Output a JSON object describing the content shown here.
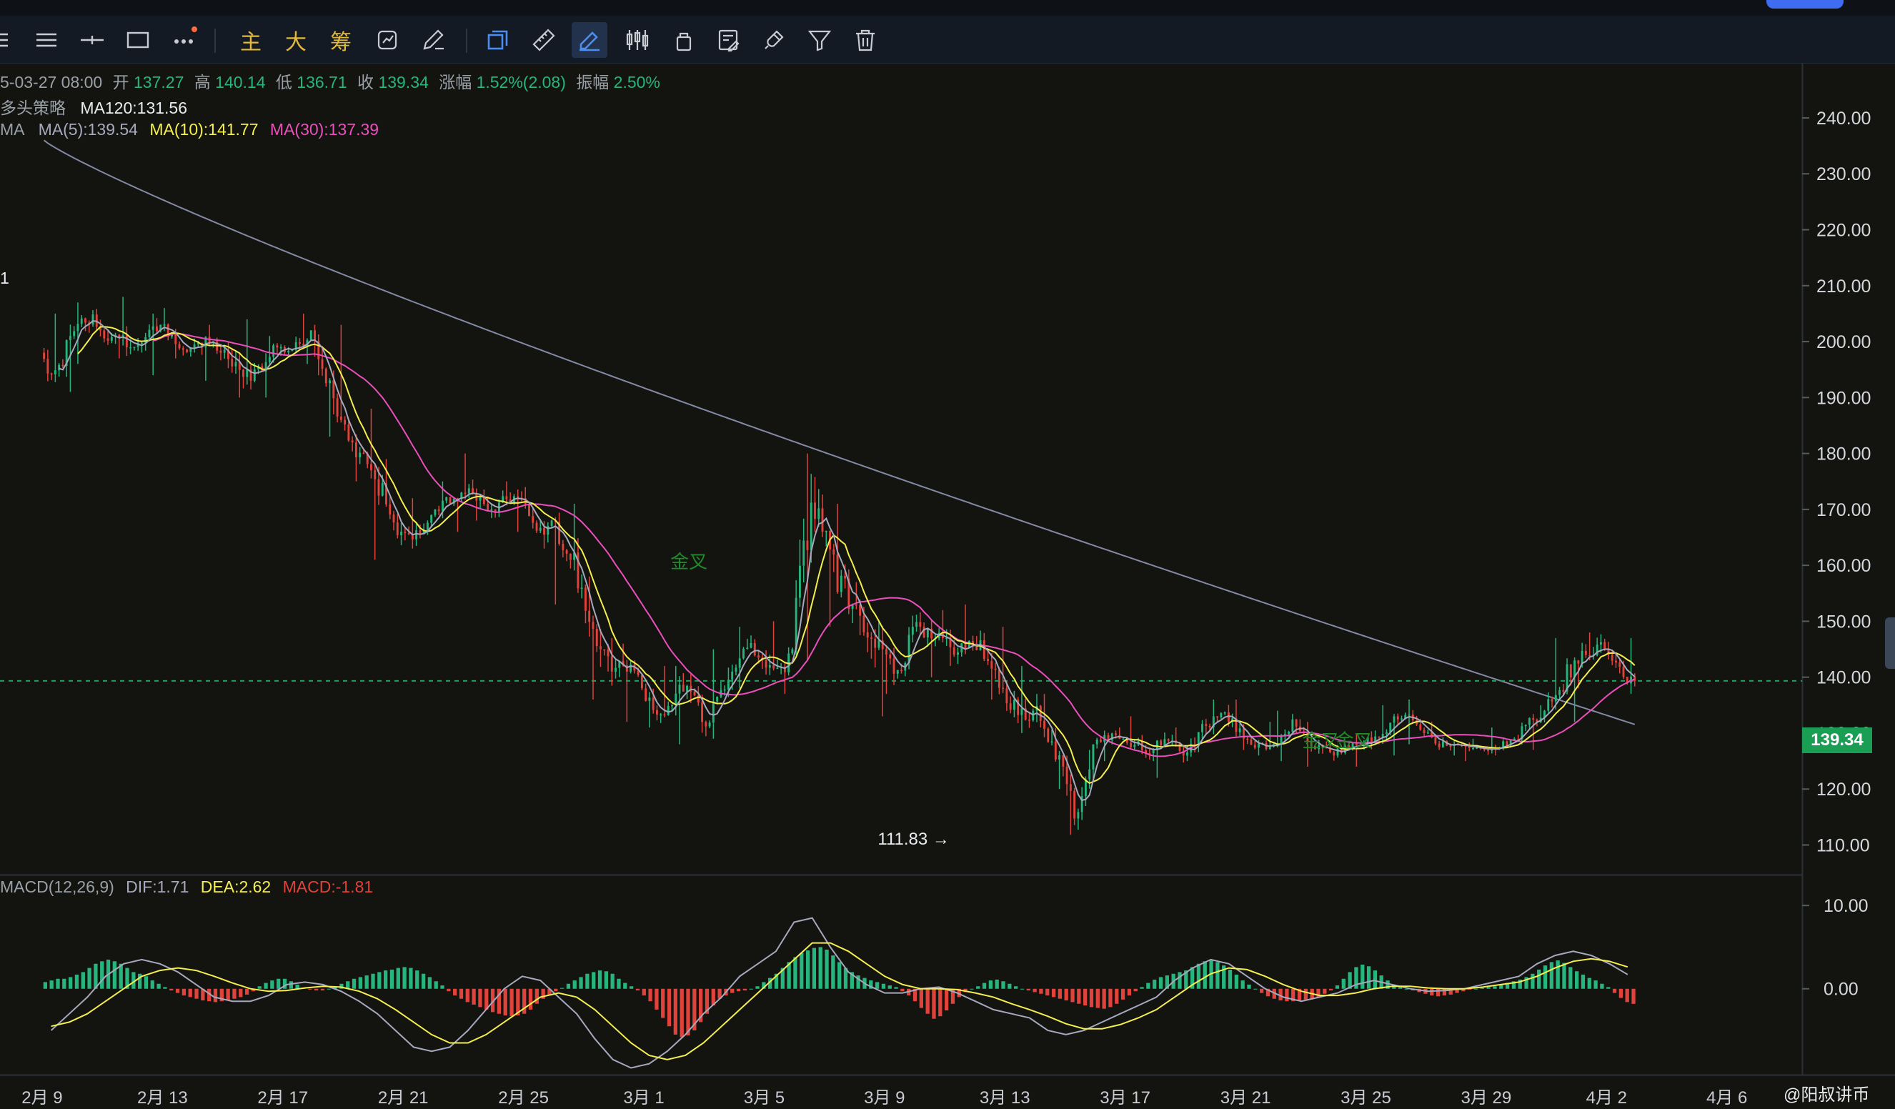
{
  "toolbar": {
    "text_buttons": [
      "主",
      "大",
      "筹"
    ]
  },
  "info_bar": {
    "date": "5-03-27 08:00",
    "open_label": "开",
    "open": "137.27",
    "high_label": "高",
    "high": "140.14",
    "low_label": "低",
    "low": "136.71",
    "close_label": "收",
    "close": "139.34",
    "change_label": "涨幅",
    "change": "1.52%(2.08)",
    "amplitude_label": "振幅",
    "amplitude": "2.50%"
  },
  "strategy_bar": {
    "name": "多头策略",
    "ma120": "MA120:131.56"
  },
  "ma_bar": {
    "prefix": "MA",
    "ma5": "MA(5):139.54",
    "ma10": "MA(10):141.77",
    "ma30": "MA(30):137.39"
  },
  "left_mark": "1",
  "macd_bar": {
    "name": "MACD(12,26,9)",
    "dif": "DIF:1.71",
    "dea": "DEA:2.62",
    "macd": "MACD:-1.81"
  },
  "watermark": "@阳叔讲币",
  "colors": {
    "background": "#131410",
    "up": "#26b57c",
    "down": "#e0423c",
    "ma5": "#a6a9bd",
    "ma10": "#f4ee4f",
    "ma30": "#ea4fbb",
    "ma120": "#8489a6",
    "last_price_tag": "#1a9e53",
    "cross_marker": "#1f8a2a"
  },
  "chart_data": [
    {
      "type": "candlestick",
      "title": "",
      "y_ticks": [
        "240.00",
        "230.00",
        "220.00",
        "210.00",
        "200.00",
        "190.00",
        "180.00",
        "170.00",
        "160.00",
        "150.00",
        "140.00",
        "130.00",
        "120.00",
        "110.00"
      ],
      "ylim": [
        107,
        246
      ],
      "x_ticks": [
        "2月 9",
        "2月 13",
        "2月 17",
        "2月 21",
        "2月 25",
        "3月 1",
        "3月 5",
        "3月 9",
        "3月 13",
        "3月 17",
        "3月 21",
        "3月 25",
        "3月 29",
        "4月 2",
        "4月 6"
      ],
      "x_tick_days": [
        0,
        4,
        8,
        12,
        16,
        20,
        24,
        28,
        32,
        36,
        40,
        44,
        48,
        52,
        56
      ],
      "x_range_days": [
        -1.4,
        58.5
      ],
      "last_price": "139.34",
      "low_marker": {
        "day": 30.4,
        "value": 111.83,
        "label": "111.83 →"
      },
      "cross_markers": [
        {
          "day": 21.5,
          "value": 159.5,
          "label": "金叉"
        },
        {
          "day": 42.5,
          "value": 127.5,
          "label": "金叉"
        },
        {
          "day": 43.6,
          "value": 127.5,
          "label": "金叉"
        }
      ],
      "daily_ohlc": [
        [
          198,
          205,
          191,
          201
        ],
        [
          201,
          207,
          196,
          202
        ],
        [
          202,
          208,
          197,
          199
        ],
        [
          199,
          205,
          194,
          203
        ],
        [
          203,
          206,
          197,
          199
        ],
        [
          199,
          203,
          193,
          198
        ],
        [
          198,
          204,
          190,
          193
        ],
        [
          193,
          201,
          190,
          199
        ],
        [
          199,
          205,
          196,
          202
        ],
        [
          202,
          203,
          183,
          186
        ],
        [
          186,
          188,
          175,
          177
        ],
        [
          177,
          179,
          161,
          166
        ],
        [
          166,
          172,
          163,
          169
        ],
        [
          169,
          175,
          166,
          173
        ],
        [
          173,
          180,
          168,
          170
        ],
        [
          170,
          175,
          166,
          172
        ],
        [
          172,
          174,
          163,
          168
        ],
        [
          168,
          171,
          153,
          156
        ],
        [
          156,
          158,
          136,
          141
        ],
        [
          141,
          146,
          132,
          138
        ],
        [
          138,
          142,
          131,
          135
        ],
        [
          135,
          142,
          128,
          132
        ],
        [
          132,
          145,
          129,
          141
        ],
        [
          141,
          149,
          138,
          143
        ],
        [
          143,
          150,
          137,
          145
        ],
        [
          145,
          180,
          143,
          166
        ],
        [
          166,
          171,
          149,
          153
        ],
        [
          153,
          157,
          133,
          145
        ],
        [
          145,
          151,
          137,
          149
        ],
        [
          149,
          152,
          140,
          147
        ],
        [
          147,
          153,
          142,
          146
        ],
        [
          146,
          149,
          136,
          138
        ],
        [
          138,
          142,
          130,
          134
        ],
        [
          134,
          137,
          120,
          124
        ],
        [
          124,
          127,
          111.83,
          128
        ],
        [
          128,
          131,
          125,
          129
        ],
        [
          129,
          133,
          125,
          127
        ],
        [
          127,
          131,
          122,
          126
        ],
        [
          126,
          136,
          125,
          133
        ],
        [
          133,
          136,
          127,
          129
        ],
        [
          129,
          132,
          126,
          128
        ],
        [
          128,
          134,
          125,
          130
        ],
        [
          130,
          132,
          124,
          126
        ],
        [
          126,
          130,
          124,
          128
        ],
        [
          128,
          135,
          126,
          133
        ],
        [
          133,
          136,
          128,
          130
        ],
        [
          130,
          132,
          126,
          128
        ],
        [
          128,
          129,
          125,
          127
        ],
        [
          127,
          131,
          126,
          129
        ],
        [
          129,
          135,
          127,
          134
        ],
        [
          134,
          147,
          132,
          143
        ],
        [
          143,
          148,
          138,
          145
        ],
        [
          145,
          147,
          137,
          139.34
        ]
      ]
    },
    {
      "type": "macd",
      "title": "",
      "y_ticks": [
        "10.00",
        "0.00"
      ],
      "ylim": [
        -9.8,
        12.5
      ],
      "series": [
        {
          "name": "DIF",
          "values": [
            -5,
            -3,
            -1,
            1.5,
            3,
            3.5,
            3,
            2,
            0.5,
            -1,
            -1.5,
            -1.5,
            -0.8,
            0.5,
            0.8,
            0.5,
            -0.3,
            -1.5,
            -3,
            -5,
            -7,
            -7.5,
            -7,
            -5,
            -2.5,
            0,
            1.5,
            1,
            -1,
            -3,
            -6,
            -8.5,
            -9.5,
            -9,
            -7.5,
            -5.5,
            -3,
            -1,
            1.5,
            3,
            4.5,
            8,
            8.5,
            5,
            2,
            0.5,
            -0.5,
            -0.5,
            0,
            0.2,
            -0.5,
            -1.5,
            -2.5,
            -3,
            -3.5,
            -5,
            -5.5,
            -5,
            -4,
            -3,
            -2,
            -1,
            1,
            2.5,
            3.5,
            3,
            1.5,
            0,
            -1,
            -1.5,
            -1,
            -0.5,
            0.5,
            1,
            0.5,
            0,
            -0.3,
            -0.2,
            0,
            0.5,
            1,
            1.5,
            3,
            4,
            4.5,
            4,
            3,
            1.71
          ]
        },
        {
          "name": "DEA",
          "values": [
            -4.5,
            -4,
            -3,
            -1.5,
            0,
            1.5,
            2.2,
            2.5,
            2.2,
            1.5,
            0.7,
            0,
            -0.3,
            -0.2,
            0.1,
            0.3,
            0.2,
            -0.3,
            -1.2,
            -2.5,
            -4,
            -5.5,
            -6.5,
            -6.5,
            -5.5,
            -4,
            -2.5,
            -1,
            -0.5,
            -1,
            -2.5,
            -4.5,
            -6.5,
            -8,
            -8.5,
            -8,
            -6.5,
            -4.5,
            -2.5,
            -0.5,
            1.5,
            3.5,
            5.5,
            5.5,
            4.5,
            3,
            1.5,
            0.5,
            0,
            0,
            -0.1,
            -0.5,
            -1,
            -1.8,
            -2.5,
            -3.3,
            -4.2,
            -4.8,
            -4.8,
            -4.3,
            -3.5,
            -2.5,
            -1,
            0.5,
            1.8,
            2.5,
            2.3,
            1.5,
            0.5,
            -0.3,
            -0.8,
            -0.8,
            -0.5,
            0,
            0.3,
            0.3,
            0.1,
            0,
            0,
            0.2,
            0.5,
            0.8,
            1.5,
            2.5,
            3.3,
            3.6,
            3.3,
            2.62
          ]
        }
      ],
      "histogram": [
        0.8,
        1,
        1.2,
        1.2,
        1.4,
        1.7,
        2,
        2.5,
        3,
        3.3,
        3.5,
        3.3,
        3,
        2.5,
        2,
        1.8,
        1.5,
        1,
        0.6,
        0.2,
        -0.2,
        -0.5,
        -0.8,
        -1,
        -1.2,
        -1.4,
        -1.5,
        -1.6,
        -1.5,
        -1.4,
        -1.2,
        -1,
        -0.7,
        -0.3,
        0.3,
        0.7,
        1,
        1.2,
        1.2,
        0.9,
        0.5,
        0.1,
        -0.1,
        -0.2,
        -0.2,
        0,
        0.3,
        0.6,
        0.9,
        1.2,
        1.4,
        1.6,
        1.8,
        2,
        2.2,
        2.3,
        2.5,
        2.6,
        2.5,
        2.2,
        1.8,
        1.4,
        0.9,
        0.4,
        -0.3,
        -0.8,
        -1.2,
        -1.6,
        -1.9,
        -2.2,
        -2.5,
        -2.8,
        -3,
        -3.2,
        -3.3,
        -3.2,
        -3,
        -2.5,
        -1.8,
        -1.2,
        -0.8,
        -0.3,
        0.1,
        0.6,
        1,
        1.4,
        1.8,
        2,
        2.2,
        2.1,
        1.8,
        1.2,
        0.7,
        0.3,
        -0.2,
        -0.8,
        -1.5,
        -2.5,
        -3.5,
        -4.5,
        -5.5,
        -5.8,
        -5.6,
        -5,
        -4,
        -3,
        -2,
        -1.2,
        -0.8,
        -0.5,
        -0.3,
        -0.2,
        0,
        0.3,
        0.8,
        1.3,
        1.8,
        2.5,
        3.2,
        3.8,
        4.3,
        4.6,
        4.9,
        5,
        4.7,
        4,
        3.2,
        2.5,
        2,
        1.6,
        1.3,
        1,
        0.8,
        0.6,
        0.4,
        0.2,
        -0.3,
        -0.8,
        -1.5,
        -2.3,
        -3,
        -3.6,
        -3.3,
        -2.6,
        -1.8,
        -1,
        -0.4,
        0,
        0.3,
        0.7,
        1,
        1.1,
        0.9,
        0.6,
        0.3,
        0,
        -0.2,
        -0.4,
        -0.6,
        -0.8,
        -1,
        -1.2,
        -1.4,
        -1.6,
        -1.8,
        -2,
        -2.2,
        -2.3,
        -2.4,
        -2.2,
        -1.8,
        -1.3,
        -0.8,
        -0.3,
        0.2,
        0.7,
        1.1,
        1.4,
        1.6,
        1.8,
        2,
        2.2,
        2.6,
        3,
        3.3,
        3.4,
        3.2,
        2.8,
        2.3,
        1.7,
        1,
        0.5,
        0,
        -0.5,
        -0.9,
        -1.2,
        -1.4,
        -1.5,
        -1.5,
        -1.4,
        -1.3,
        -1.2,
        -1,
        -0.6,
        -0.2,
        0.4,
        1.2,
        2,
        2.6,
        2.9,
        2.7,
        2.2,
        1.6,
        1,
        0.5,
        0.2,
        0,
        -0.2,
        -0.4,
        -0.6,
        -0.8,
        -0.9,
        -0.8,
        -0.7,
        -0.5,
        -0.3,
        -0.1,
        0,
        0.1,
        0.2,
        0.3,
        0.5,
        0.7,
        0.9,
        1.1,
        1.4,
        1.8,
        2.3,
        2.8,
        3.2,
        3.4,
        3.1,
        2.6,
        2.1,
        1.7,
        1.3,
        1,
        0.6,
        0.2,
        -0.5,
        -1.1,
        -1.6,
        -1.81
      ]
    }
  ]
}
